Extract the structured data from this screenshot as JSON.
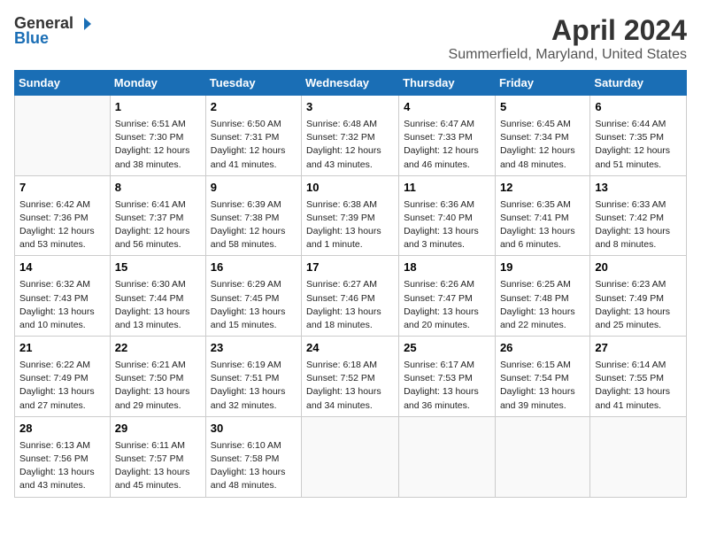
{
  "header": {
    "logo_general": "General",
    "logo_blue": "Blue",
    "title": "April 2024",
    "subtitle": "Summerfield, Maryland, United States"
  },
  "days_of_week": [
    "Sunday",
    "Monday",
    "Tuesday",
    "Wednesday",
    "Thursday",
    "Friday",
    "Saturday"
  ],
  "weeks": [
    [
      {
        "num": "",
        "empty": true
      },
      {
        "num": "1",
        "sunrise": "Sunrise: 6:51 AM",
        "sunset": "Sunset: 7:30 PM",
        "daylight": "Daylight: 12 hours and 38 minutes."
      },
      {
        "num": "2",
        "sunrise": "Sunrise: 6:50 AM",
        "sunset": "Sunset: 7:31 PM",
        "daylight": "Daylight: 12 hours and 41 minutes."
      },
      {
        "num": "3",
        "sunrise": "Sunrise: 6:48 AM",
        "sunset": "Sunset: 7:32 PM",
        "daylight": "Daylight: 12 hours and 43 minutes."
      },
      {
        "num": "4",
        "sunrise": "Sunrise: 6:47 AM",
        "sunset": "Sunset: 7:33 PM",
        "daylight": "Daylight: 12 hours and 46 minutes."
      },
      {
        "num": "5",
        "sunrise": "Sunrise: 6:45 AM",
        "sunset": "Sunset: 7:34 PM",
        "daylight": "Daylight: 12 hours and 48 minutes."
      },
      {
        "num": "6",
        "sunrise": "Sunrise: 6:44 AM",
        "sunset": "Sunset: 7:35 PM",
        "daylight": "Daylight: 12 hours and 51 minutes."
      }
    ],
    [
      {
        "num": "7",
        "sunrise": "Sunrise: 6:42 AM",
        "sunset": "Sunset: 7:36 PM",
        "daylight": "Daylight: 12 hours and 53 minutes."
      },
      {
        "num": "8",
        "sunrise": "Sunrise: 6:41 AM",
        "sunset": "Sunset: 7:37 PM",
        "daylight": "Daylight: 12 hours and 56 minutes."
      },
      {
        "num": "9",
        "sunrise": "Sunrise: 6:39 AM",
        "sunset": "Sunset: 7:38 PM",
        "daylight": "Daylight: 12 hours and 58 minutes."
      },
      {
        "num": "10",
        "sunrise": "Sunrise: 6:38 AM",
        "sunset": "Sunset: 7:39 PM",
        "daylight": "Daylight: 13 hours and 1 minute."
      },
      {
        "num": "11",
        "sunrise": "Sunrise: 6:36 AM",
        "sunset": "Sunset: 7:40 PM",
        "daylight": "Daylight: 13 hours and 3 minutes."
      },
      {
        "num": "12",
        "sunrise": "Sunrise: 6:35 AM",
        "sunset": "Sunset: 7:41 PM",
        "daylight": "Daylight: 13 hours and 6 minutes."
      },
      {
        "num": "13",
        "sunrise": "Sunrise: 6:33 AM",
        "sunset": "Sunset: 7:42 PM",
        "daylight": "Daylight: 13 hours and 8 minutes."
      }
    ],
    [
      {
        "num": "14",
        "sunrise": "Sunrise: 6:32 AM",
        "sunset": "Sunset: 7:43 PM",
        "daylight": "Daylight: 13 hours and 10 minutes."
      },
      {
        "num": "15",
        "sunrise": "Sunrise: 6:30 AM",
        "sunset": "Sunset: 7:44 PM",
        "daylight": "Daylight: 13 hours and 13 minutes."
      },
      {
        "num": "16",
        "sunrise": "Sunrise: 6:29 AM",
        "sunset": "Sunset: 7:45 PM",
        "daylight": "Daylight: 13 hours and 15 minutes."
      },
      {
        "num": "17",
        "sunrise": "Sunrise: 6:27 AM",
        "sunset": "Sunset: 7:46 PM",
        "daylight": "Daylight: 13 hours and 18 minutes."
      },
      {
        "num": "18",
        "sunrise": "Sunrise: 6:26 AM",
        "sunset": "Sunset: 7:47 PM",
        "daylight": "Daylight: 13 hours and 20 minutes."
      },
      {
        "num": "19",
        "sunrise": "Sunrise: 6:25 AM",
        "sunset": "Sunset: 7:48 PM",
        "daylight": "Daylight: 13 hours and 22 minutes."
      },
      {
        "num": "20",
        "sunrise": "Sunrise: 6:23 AM",
        "sunset": "Sunset: 7:49 PM",
        "daylight": "Daylight: 13 hours and 25 minutes."
      }
    ],
    [
      {
        "num": "21",
        "sunrise": "Sunrise: 6:22 AM",
        "sunset": "Sunset: 7:49 PM",
        "daylight": "Daylight: 13 hours and 27 minutes."
      },
      {
        "num": "22",
        "sunrise": "Sunrise: 6:21 AM",
        "sunset": "Sunset: 7:50 PM",
        "daylight": "Daylight: 13 hours and 29 minutes."
      },
      {
        "num": "23",
        "sunrise": "Sunrise: 6:19 AM",
        "sunset": "Sunset: 7:51 PM",
        "daylight": "Daylight: 13 hours and 32 minutes."
      },
      {
        "num": "24",
        "sunrise": "Sunrise: 6:18 AM",
        "sunset": "Sunset: 7:52 PM",
        "daylight": "Daylight: 13 hours and 34 minutes."
      },
      {
        "num": "25",
        "sunrise": "Sunrise: 6:17 AM",
        "sunset": "Sunset: 7:53 PM",
        "daylight": "Daylight: 13 hours and 36 minutes."
      },
      {
        "num": "26",
        "sunrise": "Sunrise: 6:15 AM",
        "sunset": "Sunset: 7:54 PM",
        "daylight": "Daylight: 13 hours and 39 minutes."
      },
      {
        "num": "27",
        "sunrise": "Sunrise: 6:14 AM",
        "sunset": "Sunset: 7:55 PM",
        "daylight": "Daylight: 13 hours and 41 minutes."
      }
    ],
    [
      {
        "num": "28",
        "sunrise": "Sunrise: 6:13 AM",
        "sunset": "Sunset: 7:56 PM",
        "daylight": "Daylight: 13 hours and 43 minutes."
      },
      {
        "num": "29",
        "sunrise": "Sunrise: 6:11 AM",
        "sunset": "Sunset: 7:57 PM",
        "daylight": "Daylight: 13 hours and 45 minutes."
      },
      {
        "num": "30",
        "sunrise": "Sunrise: 6:10 AM",
        "sunset": "Sunset: 7:58 PM",
        "daylight": "Daylight: 13 hours and 48 minutes."
      },
      {
        "num": "",
        "empty": true
      },
      {
        "num": "",
        "empty": true
      },
      {
        "num": "",
        "empty": true
      },
      {
        "num": "",
        "empty": true
      }
    ]
  ]
}
